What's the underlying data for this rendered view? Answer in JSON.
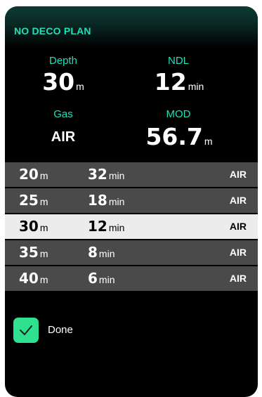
{
  "header": {
    "title": "NO DECO PLAN"
  },
  "summary": {
    "depth": {
      "label": "Depth",
      "value": "30",
      "unit": "m"
    },
    "ndl": {
      "label": "NDL",
      "value": "12",
      "unit": "min"
    },
    "gas": {
      "label": "Gas",
      "value": "AIR"
    },
    "mod": {
      "label": "MOD",
      "value": "56.7",
      "unit": "m"
    }
  },
  "table": {
    "rows": [
      {
        "depth": "20",
        "depth_unit": "m",
        "ndl": "32",
        "ndl_unit": "min",
        "gas": "AIR",
        "selected": false
      },
      {
        "depth": "25",
        "depth_unit": "m",
        "ndl": "18",
        "ndl_unit": "min",
        "gas": "AIR",
        "selected": false
      },
      {
        "depth": "30",
        "depth_unit": "m",
        "ndl": "12",
        "ndl_unit": "min",
        "gas": "AIR",
        "selected": true
      },
      {
        "depth": "35",
        "depth_unit": "m",
        "ndl": "8",
        "ndl_unit": "min",
        "gas": "AIR",
        "selected": false
      },
      {
        "depth": "40",
        "depth_unit": "m",
        "ndl": "6",
        "ndl_unit": "min",
        "gas": "AIR",
        "selected": false
      }
    ]
  },
  "done": {
    "label": "Done",
    "checked": true,
    "icon": "check-icon"
  },
  "colors": {
    "accent": "#1fe0b8",
    "checkbox": "#2fe08f",
    "row": "#4a4a4a",
    "row_selected": "#ececec"
  }
}
